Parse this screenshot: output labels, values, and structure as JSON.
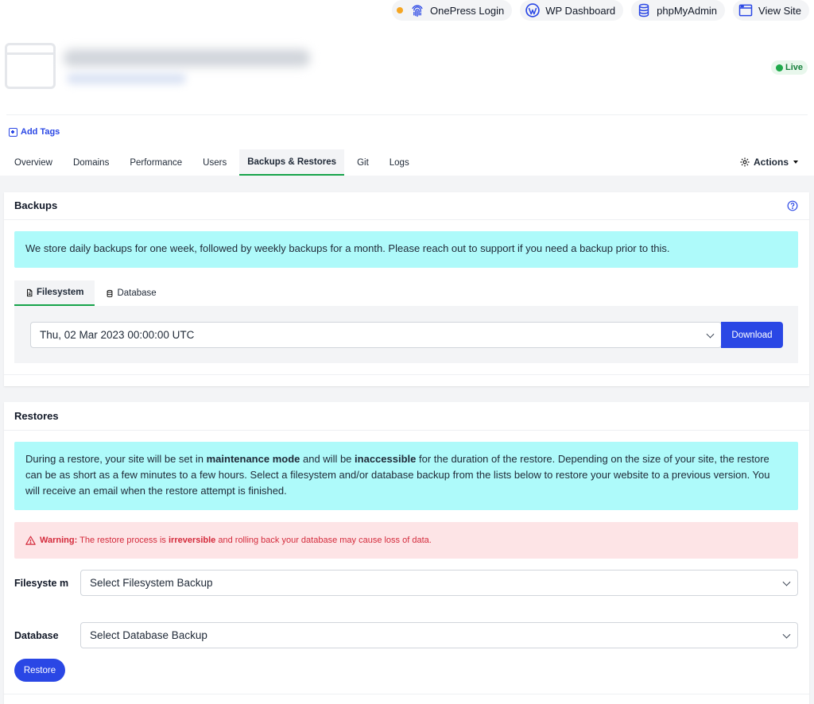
{
  "toplinks": [
    {
      "label": "OnePress Login",
      "icon": "fingerprint-icon"
    },
    {
      "label": "WP Dashboard",
      "icon": "wordpress-icon"
    },
    {
      "label": "phpMyAdmin",
      "icon": "database-icon"
    },
    {
      "label": "View Site",
      "icon": "browser-window-icon"
    }
  ],
  "header": {
    "status": "Live",
    "add_tags": "Add Tags",
    "actions": "Actions"
  },
  "tabs": [
    "Overview",
    "Domains",
    "Performance",
    "Users",
    "Backups & Restores",
    "Git",
    "Logs"
  ],
  "backups": {
    "title": "Backups",
    "info": "We store daily backups for one week, followed by weekly backups for a month. Please reach out to support if you need a backup prior to this.",
    "subtabs": [
      "Filesystem",
      "Database"
    ],
    "selected_backup": "Thu, 02 Mar 2023 00:00:00 UTC",
    "download": "Download"
  },
  "restores": {
    "title": "Restores",
    "info_parts": [
      "During a restore, your site will be set in ",
      "maintenance mode",
      " and will be ",
      "inaccessible",
      " for the duration of the restore. Depending on the size of your site, the restore can be as short as a few minutes to a few hours. Select a filesystem and/or database backup from the lists below to restore your website to a previous version. You will receive an email when the restore attempt is finished."
    ],
    "warning_label": "Warning:",
    "warning_parts": [
      " The restore process is ",
      "irreversible",
      " and rolling back your database may cause loss of data."
    ],
    "filesystem_label": "Filesyste m",
    "filesystem_placeholder": "Select Filesystem Backup",
    "database_label": "Database",
    "database_placeholder": "Select Database Backup",
    "restore_button": "Restore"
  },
  "colors": {
    "accent": "#2a47e5",
    "info_bg": "#aefafa",
    "warning_bg": "#fde4e6",
    "warning_text": "#d42b3c",
    "live_green": "#1ea94a"
  }
}
